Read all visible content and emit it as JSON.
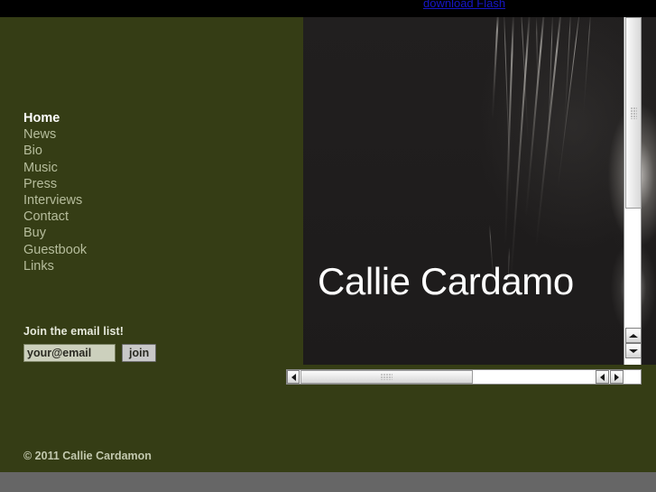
{
  "browser": {
    "flash_link_label": "download Flash"
  },
  "sidebar": {
    "nav": [
      {
        "label": "Home",
        "active": true
      },
      {
        "label": "News",
        "active": false
      },
      {
        "label": "Bio",
        "active": false
      },
      {
        "label": "Music",
        "active": false
      },
      {
        "label": "Press",
        "active": false
      },
      {
        "label": "Interviews",
        "active": false
      },
      {
        "label": "Contact",
        "active": false
      },
      {
        "label": "Buy",
        "active": false
      },
      {
        "label": "Guestbook",
        "active": false
      },
      {
        "label": "Links",
        "active": false
      }
    ],
    "signup": {
      "heading": "Join the email list!",
      "email_value": "",
      "email_placeholder": "your@email",
      "join_label": "join"
    },
    "copyright": "© 2011 Callie Cardamon"
  },
  "flash": {
    "title": "Callie Cardamo",
    "full_title": "Callie Cardamon"
  },
  "scrollbars": {
    "vertical": {
      "up_icon": "triangle-up-icon",
      "down_icon": "triangle-down-icon",
      "thumb_icon": "scrollbar-grip-icon"
    },
    "horizontal": {
      "left_icon": "triangle-left-icon",
      "back_icon": "triangle-left-icon",
      "forward_icon": "triangle-right-icon",
      "thumb_icon": "scrollbar-grip-icon"
    }
  },
  "colors": {
    "olive_background": "#353d15",
    "nav_text": "#b6bd9c",
    "nav_active_text": "#ffffff",
    "flash_panel": "#211f1f",
    "link_blue": "#1616c8",
    "bottom_strip": "#666666"
  }
}
